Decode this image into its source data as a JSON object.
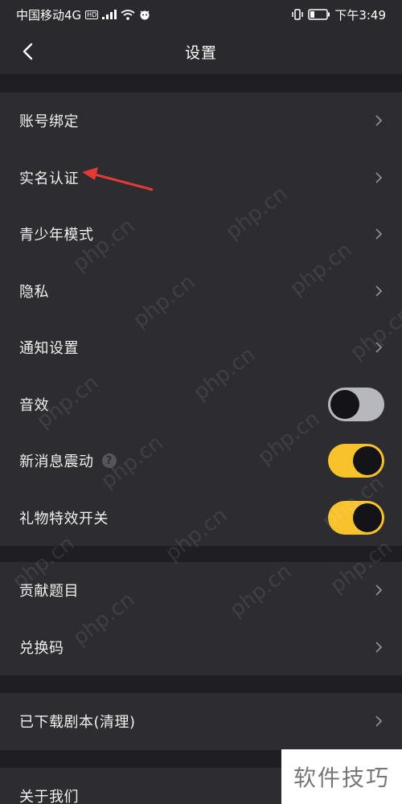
{
  "status_bar": {
    "carrier": "中国移动4G",
    "hd_badge": "HD",
    "network": "4G",
    "time": "下午3:49"
  },
  "header": {
    "title": "设置"
  },
  "sections": [
    {
      "rows": [
        {
          "label": "账号绑定",
          "type": "chevron"
        },
        {
          "label": "实名认证",
          "type": "chevron"
        },
        {
          "label": "青少年模式",
          "type": "chevron"
        },
        {
          "label": "隐私",
          "type": "chevron"
        },
        {
          "label": "通知设置",
          "type": "chevron"
        },
        {
          "label": "音效",
          "type": "toggle",
          "on": false
        },
        {
          "label": "新消息震动",
          "type": "toggle",
          "on": true,
          "help": "?"
        },
        {
          "label": "礼物特效开关",
          "type": "toggle",
          "on": true
        }
      ]
    },
    {
      "rows": [
        {
          "label": "贡献题目",
          "type": "chevron"
        },
        {
          "label": "兑换码",
          "type": "chevron"
        }
      ]
    },
    {
      "rows": [
        {
          "label": "已下载剧本(清理)",
          "type": "chevron"
        }
      ]
    },
    {
      "rows": [
        {
          "label": "关于我们",
          "type": "chevron"
        }
      ]
    }
  ],
  "watermark": {
    "corner_text": "软件技巧",
    "overlay_text": "php.cn"
  },
  "colors": {
    "background": "#1f1f23",
    "section_bg": "#2d2d31",
    "toggle_on": "#f8c22c",
    "toggle_off": "#b7b8be",
    "annotation_arrow": "#e53935"
  }
}
